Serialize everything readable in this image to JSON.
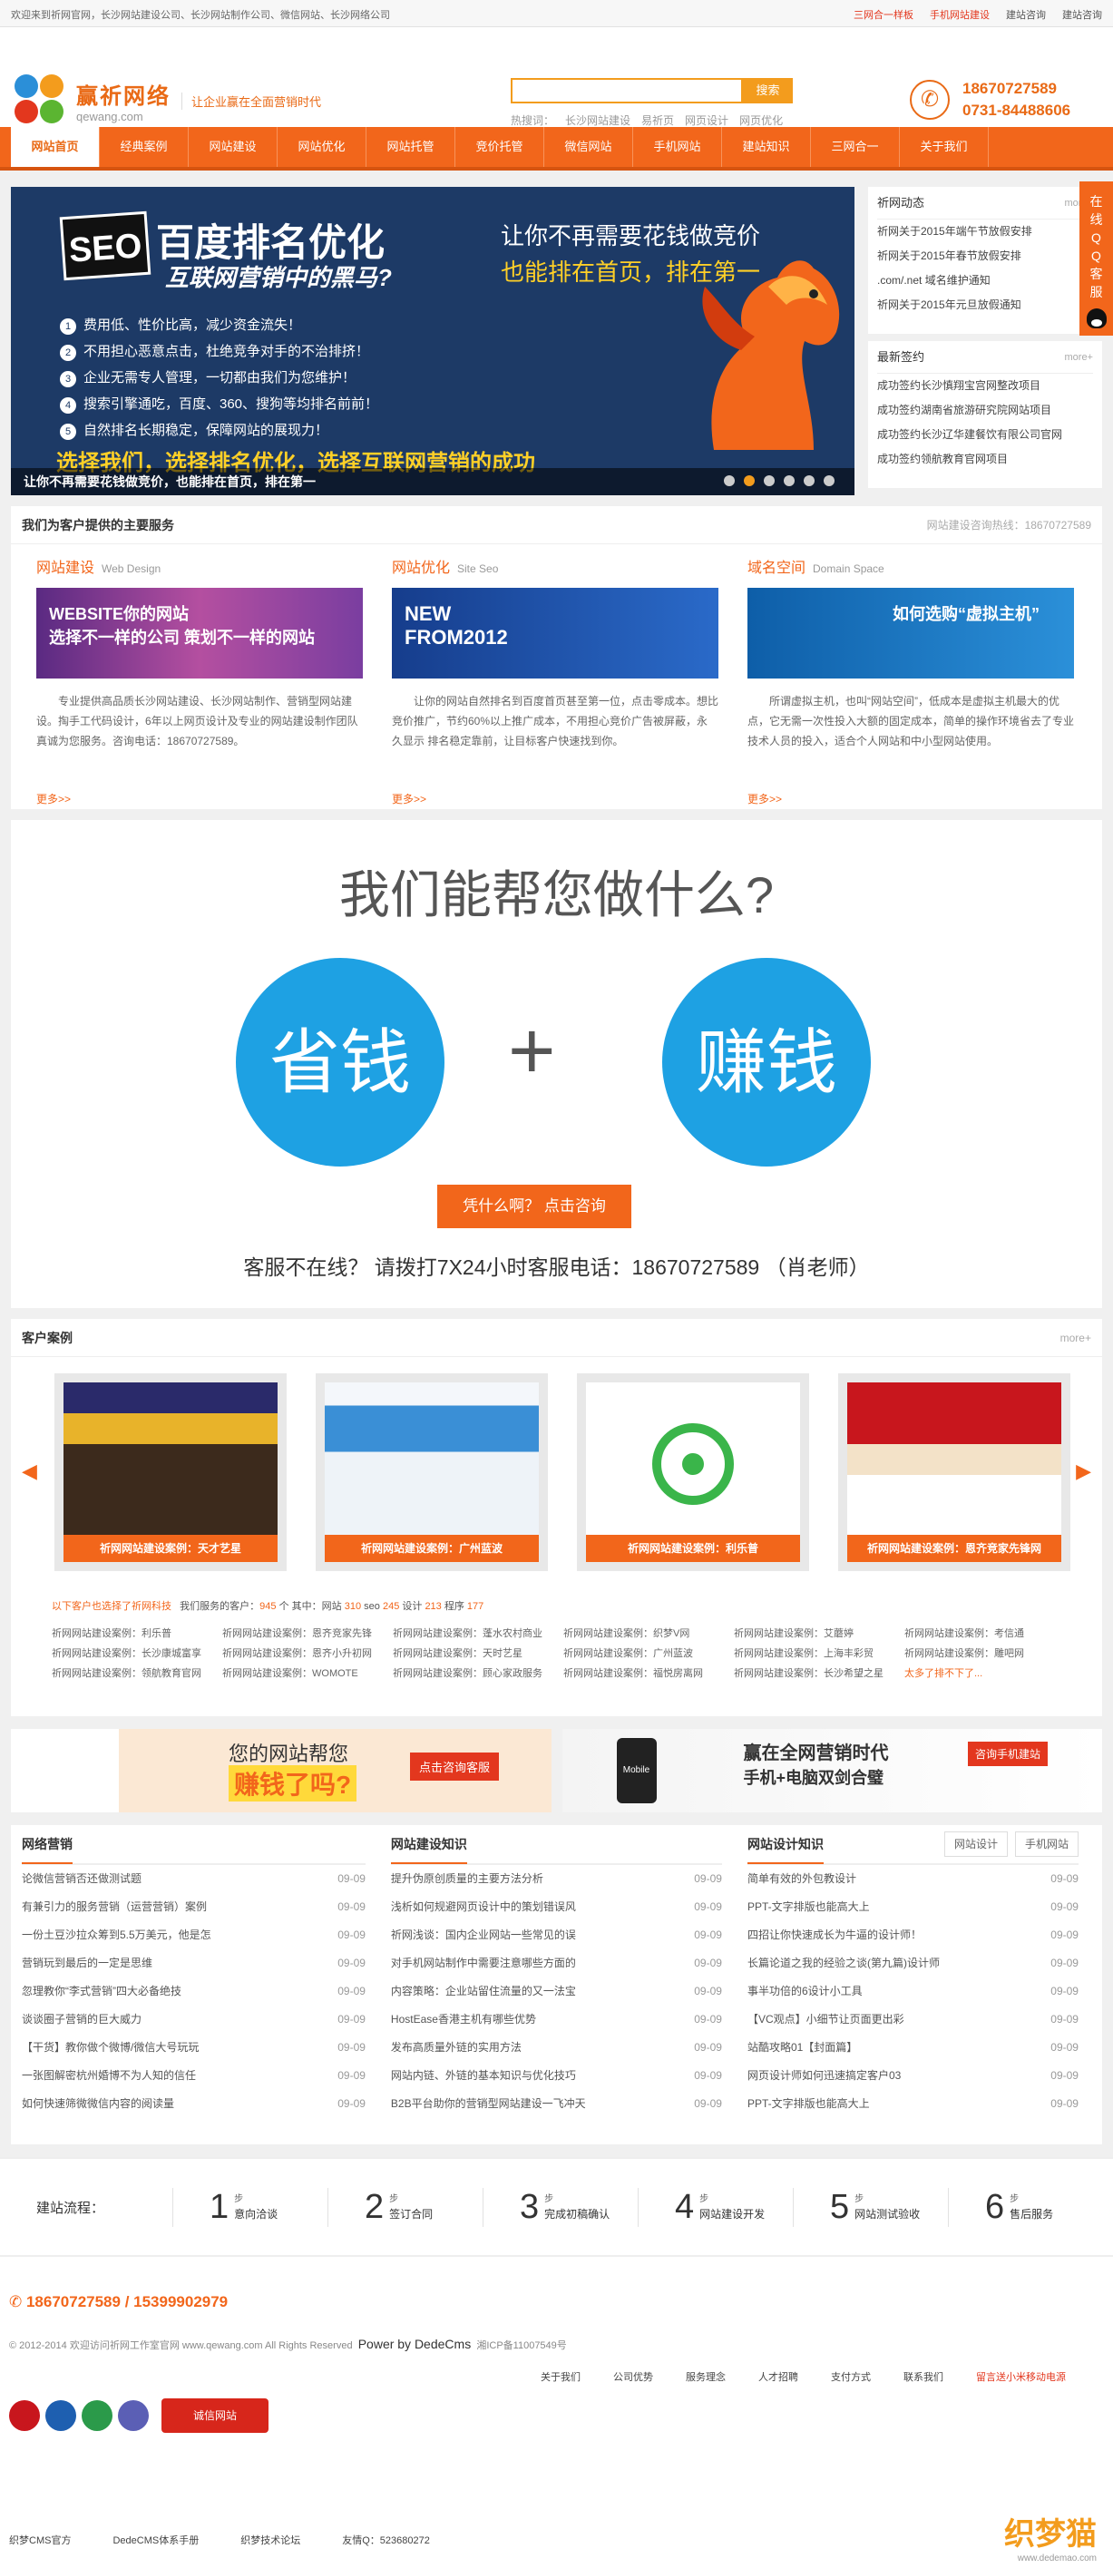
{
  "topbar": {
    "welcome": "欢迎来到祈网官网，长沙网站建设公司、长沙网站制作公司、微信网站、长沙网络公司",
    "links": [
      "三网合一样板",
      "手机网站建设",
      "建站咨询",
      "建站咨询"
    ]
  },
  "header": {
    "brand_cn": "赢祈网络",
    "brand_en": "qewang.com",
    "slogan": "让企业赢在全面营销时代",
    "search_button": "搜索",
    "hotwords_label": "热搜词：",
    "hotwords": [
      "长沙网站建设",
      "易祈页",
      "网页设计",
      "网页优化"
    ],
    "phone1": "18670727589",
    "phone2": "0731-84488606"
  },
  "nav": [
    "网站首页",
    "经典案例",
    "网站建设",
    "网站优化",
    "网站托管",
    "竞价托管",
    "微信网站",
    "手机网站",
    "建站知识",
    "三网合一",
    "关于我们"
  ],
  "banner": {
    "seo": "SEO",
    "title": "百度排名优化",
    "subtitle": "互联网营销中的黑马?",
    "right1": "让你不再需要花钱做竞价",
    "right2": "也能排在首页，排在第一",
    "points": [
      "费用低、性价比高，减少资金流失！",
      "不用担心恶意点击，杜绝竞争对手的不治排挤！",
      "企业无需专人管理，一切都由我们为您维护！",
      "搜索引擎通吃，百度、360、搜狗等均排名前前！",
      "自然排名长期稳定，保障网站的展现力！"
    ],
    "choose": "选择我们，选择排名优化，选择互联网营销的成功",
    "caption": "让你不再需要花钱做竞价，也能排在首页，排在第一"
  },
  "news": {
    "title": "祈网动态",
    "more": "more+",
    "items": [
      "祈网关于2015年端午节放假安排",
      "祈网关于2015年春节放假安排",
      ".com/.net 域名维护通知",
      "祈网关于2015年元旦放假通知"
    ]
  },
  "signed": {
    "title": "最新签约",
    "more": "more+",
    "items": [
      "成功签约长沙慎翔宝宫网整改项目",
      "成功签约湖南省旅游研究院网站项目",
      "成功签约长沙辽华建餐饮有限公司官网",
      "成功签约领航教育官网项目"
    ]
  },
  "qq": {
    "label": "在线QQ客服"
  },
  "services": {
    "title": "我们为客户提供的主要服务",
    "hotline": "网站建设咨询热线：18670727589",
    "items": [
      {
        "title": "网站建设",
        "en": "Web Design",
        "img_text": "WEBSITE你的网站\n选择不一样的公司 策划不一样的网站",
        "desc": "专业提供高品质长沙网站建设、长沙网站制作、营销型网站建设。掏手工代码设计，6年以上网页设计及专业的网站建设制作团队真诚为您服务。咨询电话：18670727589。",
        "more": "更多>>"
      },
      {
        "title": "网站优化",
        "en": "Site Seo",
        "img_text": "NEW\nFROM2012",
        "desc": "让你的网站自然排名到百度首页甚至第一位，点击零成本。想比竞价推广，节约60%以上推广成本，不用担心竞价广告被屏蔽，永久显示 排名稳定靠前，让目标客户快速找到你。",
        "more": "更多>>"
      },
      {
        "title": "域名空间",
        "en": "Domain Space",
        "img_text": "如何选购“虚拟主机”",
        "desc": "所谓虚拟主机，也叫“网站空间”，低成本是虚拟主机最大的优点，它无需一次性投入大额的固定成本，简单的操作环境省去了专业技术人员的投入，适合个人网站和中小型网站使用。",
        "more": "更多>>"
      }
    ]
  },
  "help": {
    "question": "我们能帮您做什么?",
    "save": "省钱",
    "earn": "赚钱",
    "plus": "+",
    "consult_btn": "凭什么啊？  点击咨询",
    "hotline": "客服不在线？  请拨打7X24小时客服电话：18670727589 （肖老师）"
  },
  "cases": {
    "title": "客户案例",
    "more": "more+",
    "items": [
      "祈网网站建设案例：天才艺星",
      "祈网网站建设案例：广州蓝波",
      "祈网网站建设案例：利乐普",
      "祈网网站建设案例：恩齐竞家先锋网"
    ],
    "stats_prefix": "以下客户也选择了祈网科技",
    "stats_mid": "我们服务的客户：",
    "stats_total": "945",
    "stats_site_label": "个 其中：网站",
    "stats_site": "310",
    "stats_seo_label": "seo",
    "stats_seo": "245",
    "stats_design_label": "设计",
    "stats_design": "213",
    "stats_prog_label": "程序",
    "stats_prog": "177",
    "links": [
      "祈网网站建设案例：利乐普",
      "祈网网站建设案例：恩齐竞家先锋",
      "祈网网站建设案例：蓬水农村商业",
      "祈网网站建设案例：织梦V网",
      "祈网网站建设案例：艾蘑婷",
      "祈网网站建设案例：考信通",
      "祈网网站建设案例：长沙康城富享",
      "祈网网站建设案例：恩齐小升初网",
      "祈网网站建设案例：天时艺星",
      "祈网网站建设案例：广州蓝波",
      "祈网网站建设案例：上海丰彩贸",
      "祈网网站建设案例：雕吧网",
      "祈网网站建设案例：领航教育官网",
      "祈网网站建设案例：WOMOTE",
      "祈网网站建设案例：顾心家政服务",
      "祈网网站建设案例：福悦房离网",
      "祈网网站建设案例：长沙希望之星",
      "太多了排不下了..."
    ]
  },
  "ads": {
    "left_line1": "您的网站帮您",
    "left_line2": "赚钱了吗?",
    "left_btn": "点击咨询客服",
    "right_line1": "赢在全网营销时代",
    "right_line2": "手机+电脑双剑合璧",
    "right_badge": "咨询手机建站",
    "mobile": "Mobile"
  },
  "cols": [
    {
      "title": "网络营销",
      "rows": [
        [
          "论微信营销否还做测试题",
          "09-09"
        ],
        [
          "有兼引力的服务营销（运营营销）案例",
          "09-09"
        ],
        [
          "一份土豆沙拉众筹到5.5万美元，他是怎",
          "09-09"
        ],
        [
          "营销玩到最后的一定是思维",
          "09-09"
        ],
        [
          "忽理教你“李式营销”四大必备绝技",
          "09-09"
        ],
        [
          "谈谈圈子营销的巨大威力",
          "09-09"
        ],
        [
          "【干货】教你做个微博/微信大号玩玩",
          "09-09"
        ],
        [
          "一张图解密杭州婚博不为人知的信任",
          "09-09"
        ],
        [
          "如何快速筛微微信内容的阅读量",
          "09-09"
        ]
      ]
    },
    {
      "title": "网站建设知识",
      "rows": [
        [
          "提升伪原创质量的主要方法分析",
          "09-09"
        ],
        [
          "浅析如何规避网页设计中的策划错误风",
          "09-09"
        ],
        [
          "祈网浅谈：国内企业网站一些常见的误",
          "09-09"
        ],
        [
          "对手机网站制作中需要注意哪些方面的",
          "09-09"
        ],
        [
          "内容策略：企业站留住流量的又一法宝",
          "09-09"
        ],
        [
          "HostEase香港主机有哪些优势",
          "09-09"
        ],
        [
          "发布高质量外链的实用方法",
          "09-09"
        ],
        [
          "网站内链、外链的基本知识与优化技巧",
          "09-09"
        ],
        [
          "B2B平台助你的营销型网站建设一飞冲天",
          "09-09"
        ]
      ]
    },
    {
      "title": "网站设计知识",
      "tabs": [
        "网站设计",
        "手机网站"
      ],
      "rows": [
        [
          "简单有效的外包教设计",
          "09-09"
        ],
        [
          "PPT-文字排版也能高大上",
          "09-09"
        ],
        [
          "四招让你快速成长为牛逼的设计师！",
          "09-09"
        ],
        [
          "长篇论道之我的经验之谈(第九篇)设计师",
          "09-09"
        ],
        [
          "事半功倍的6设计小工具",
          "09-09"
        ],
        [
          "【VC观点】小细节让页面更出彩",
          "09-09"
        ],
        [
          "站酷攻略01【封面篇】",
          "09-09"
        ],
        [
          "网页设计师如何迅速搞定客户03",
          "09-09"
        ],
        [
          "PPT-文字排版也能高大上",
          "09-09"
        ]
      ]
    }
  ],
  "flow": {
    "label": "建站流程：",
    "step_word": "步",
    "steps": [
      [
        "1",
        "意向洽谈"
      ],
      [
        "2",
        "签订合同"
      ],
      [
        "3",
        "完成初稿确认"
      ],
      [
        "4",
        "网站建设开发"
      ],
      [
        "5",
        "网站测试验收"
      ],
      [
        "6",
        "售后服务"
      ]
    ]
  },
  "footer": {
    "phones": "18670727589 / 15399902979",
    "copyright": "© 2012-2014 欢迎访问祈网工作室官网 www.qewang.com All Rights Reserved",
    "powered": "Power by DedeCms",
    "icp": "湘ICP备11007549号",
    "links": [
      "关于我们",
      "公司优势",
      "服务理念",
      "人才招聘",
      "支付方式",
      "联系我们",
      "留言送小米移动电源"
    ],
    "bank": "诚信网站",
    "bottom": [
      "织梦CMS官方",
      "DedeCMS体系手册",
      "织梦技术论坛",
      "友情Q：523680272"
    ],
    "dede": "织梦猫",
    "dede_url": "www.dedemao.com"
  }
}
